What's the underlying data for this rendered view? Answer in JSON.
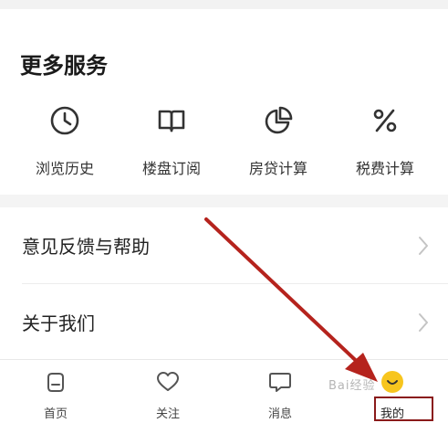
{
  "services": {
    "title": "更多服务",
    "items": [
      {
        "label": "浏览历史",
        "icon": "clock-icon"
      },
      {
        "label": "楼盘订阅",
        "icon": "book-icon"
      },
      {
        "label": "房贷计算",
        "icon": "pie-chart-icon"
      },
      {
        "label": "税费计算",
        "icon": "percent-icon"
      }
    ]
  },
  "menu": {
    "items": [
      {
        "label": "意见反馈与帮助",
        "icon": "chevron-right-icon"
      },
      {
        "label": "关于我们",
        "icon": "chevron-right-icon"
      }
    ]
  },
  "tabbar": {
    "items": [
      {
        "label": "首页",
        "icon": "home-icon"
      },
      {
        "label": "关注",
        "icon": "heart-icon"
      },
      {
        "label": "消息",
        "icon": "message-icon"
      },
      {
        "label": "我的",
        "icon": "smile-avatar-icon",
        "active": true
      }
    ]
  },
  "annotation": {
    "watermark": "Bai经验",
    "arrow_color": "#b5231d",
    "highlight_color": "#8a1a1a"
  },
  "colors": {
    "accent_yellow": "#f7c51e",
    "icon_dark": "#333333"
  }
}
